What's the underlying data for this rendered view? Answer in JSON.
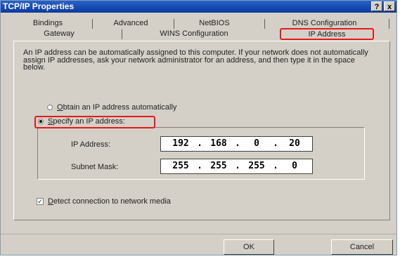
{
  "window": {
    "title": "TCP/IP Properties",
    "help_label": "?",
    "close_label": "x"
  },
  "tabs": {
    "row1": [
      "Bindings",
      "Advanced",
      "NetBIOS",
      "DNS Configuration"
    ],
    "row2": [
      "Gateway",
      "WINS Configuration",
      "IP Address"
    ],
    "active": "IP Address"
  },
  "description": "An IP address can be automatically assigned to this computer. If your network does not automatically assign IP addresses, ask your network administrator for an address, and then type it in the space below.",
  "options": {
    "auto": {
      "underlined": "O",
      "rest": "btain an IP address automatically",
      "selected": false
    },
    "specify": {
      "underlined": "S",
      "rest": "pecify an IP address:",
      "selected": true
    }
  },
  "fields": {
    "ip_label": "IP Address:",
    "ip_octets": [
      "192",
      "168",
      "0",
      "20"
    ],
    "subnet_label": "Subnet Mask:",
    "subnet_octets": [
      "255",
      "255",
      "255",
      "0"
    ],
    "separator": "."
  },
  "detect": {
    "underlined": "D",
    "rest": "etect connection to network media",
    "checked": true,
    "mark": "✓"
  },
  "buttons": {
    "ok": "OK",
    "cancel": "Cancel"
  },
  "colors": {
    "highlight": "#e8191c",
    "titlebar": "#0a3aa0",
    "face": "#d4d0c8"
  }
}
